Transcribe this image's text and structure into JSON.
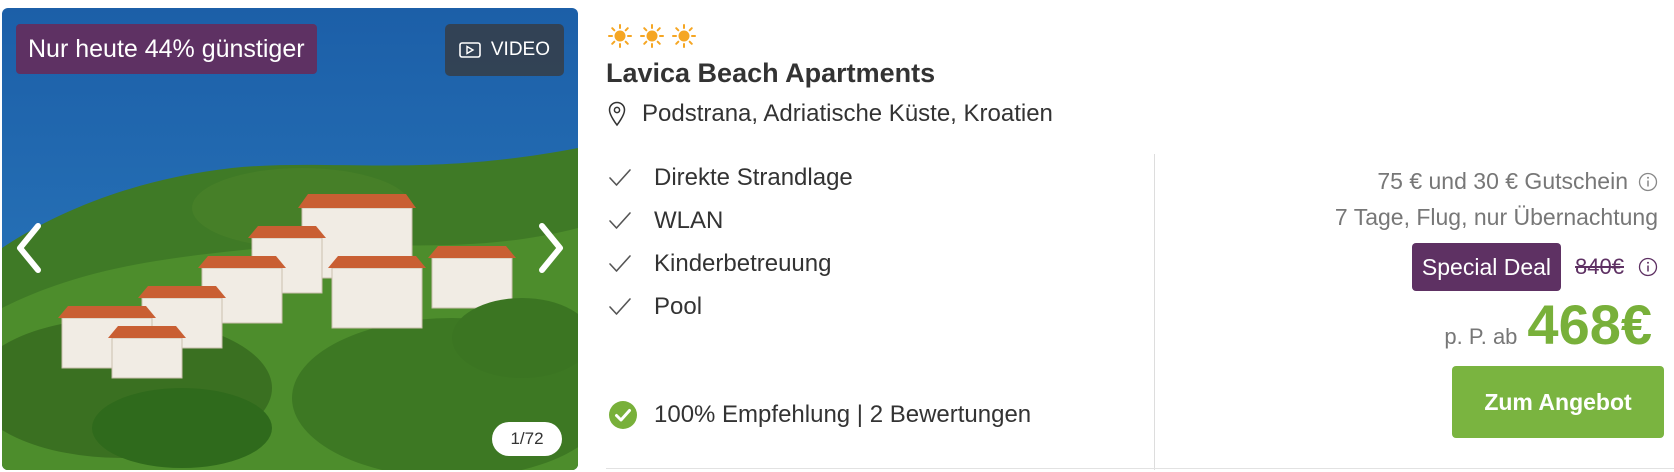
{
  "gallery": {
    "discount_badge": "Nur heute 44% günstiger",
    "video_label": "VIDEO",
    "counter": "1/72"
  },
  "hotel": {
    "star_count": 3,
    "name": "Lavica Beach Apartments",
    "location": "Podstrana, Adriatische Küste, Kroatien"
  },
  "features": [
    "Direkte Strandlage",
    "WLAN",
    "Kinderbetreuung",
    "Pool"
  ],
  "rating": {
    "text": "100% Empfehlung | 2 Bewertungen"
  },
  "pricing": {
    "voucher_text": "75 € und 30 € Gutschein",
    "trip_info": "7 Tage, Flug, nur Übernachtung",
    "special_deal_label": "Special Deal",
    "old_price": "840€",
    "price_prefix": "p. P. ab",
    "price": "468€",
    "cta_label": "Zum Angebot"
  },
  "colors": {
    "brand_purple": "#5e3163",
    "price_green": "#78b03a",
    "cta_green": "#7ab440",
    "star_orange": "#f5a623",
    "muted_text": "#777777"
  },
  "icons": [
    "video-icon",
    "chevron-left-icon",
    "chevron-right-icon",
    "sun-icon",
    "location-pin-icon",
    "checkmark-icon",
    "check-circle-icon",
    "info-icon"
  ]
}
